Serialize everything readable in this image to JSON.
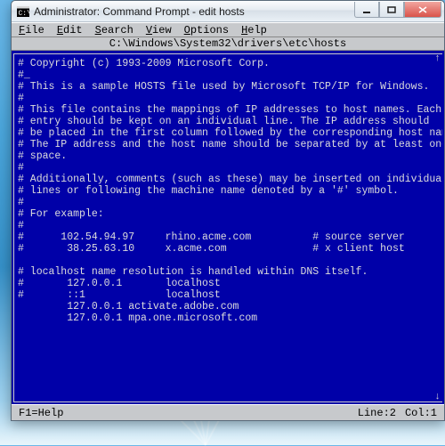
{
  "window": {
    "title": "Administrator: Command Prompt - edit  hosts"
  },
  "menus": {
    "file": "File",
    "edit": "Edit",
    "search": "Search",
    "view": "View",
    "options": "Options",
    "help": "Help"
  },
  "path": "C:\\Windows\\System32\\drivers\\etc\\hosts",
  "status": {
    "help": "F1=Help",
    "line_label": "Line:",
    "line_val": "2",
    "col_label": "Col:",
    "col_val": "1"
  },
  "hosts_lines": [
    "# Copyright (c) 1993-2009 Microsoft Corp.",
    "#_",
    "# This is a sample HOSTS file used by Microsoft TCP/IP for Windows.",
    "#",
    "# This file contains the mappings of IP addresses to host names. Each",
    "# entry should be kept on an individual line. The IP address should",
    "# be placed in the first column followed by the corresponding host name.",
    "# The IP address and the host name should be separated by at least one",
    "# space.",
    "#",
    "# Additionally, comments (such as these) may be inserted on individual",
    "# lines or following the machine name denoted by a '#' symbol.",
    "#",
    "# For example:",
    "#",
    "#      102.54.94.97     rhino.acme.com          # source server",
    "#       38.25.63.10     x.acme.com              # x client host",
    "",
    "# localhost name resolution is handled within DNS itself.",
    "#       127.0.0.1       localhost",
    "#       ::1             localhost",
    "        127.0.0.1 activate.adobe.com",
    "        127.0.0.1 mpa.one.microsoft.com"
  ]
}
